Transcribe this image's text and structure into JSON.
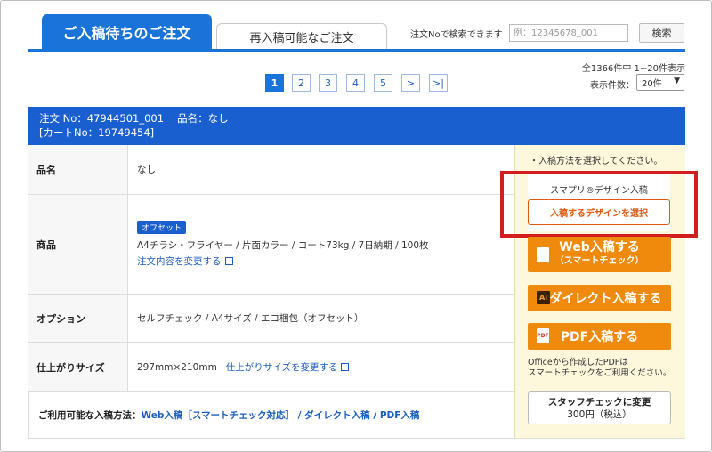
{
  "tabs": {
    "active_label": "ご入稿待ちのご注文",
    "inactive_label": "再入稿可能なご注文"
  },
  "search": {
    "label": "注文Noで検索できます",
    "placeholder": "例：12345678_001",
    "button_label": "検索"
  },
  "pagination": {
    "pages": [
      "1",
      "2",
      "3",
      "4",
      "5"
    ],
    "current": "1",
    "next_label": ">",
    "last_label": ">|"
  },
  "results": {
    "count_text": "全1366件中 1~20件表示",
    "per_page_label": "表示件数：",
    "per_page_value": "20件"
  },
  "order": {
    "header_line1": "注文 No：47944501_001　 品名：なし",
    "header_line2": "[カートNo：19749454]",
    "rows": {
      "name": {
        "label": "品名",
        "value": "なし"
      },
      "product": {
        "label": "商品",
        "badge": "オフセット",
        "value": "A4チラシ・フライヤー / 片面カラー / コート73kg / 7日納期 / 100枚",
        "link": "注文内容を変更する"
      },
      "option": {
        "label": "オプション",
        "value": "セルフチェック / A4サイズ / エコ梱包（オフセット）"
      },
      "size": {
        "label": "仕上がりサイズ",
        "value": "297mm×210mm",
        "link": "仕上がりサイズを変更する"
      }
    },
    "methods": {
      "label": "ご利用可能な入稿方法：",
      "value": "Web入稿［スマートチェック対応］ / ダイレクト入稿 / PDF入稿"
    }
  },
  "side": {
    "instruction": "・入稿方法を選択してください。",
    "sumapri_label": "スマプリ®デザイン入稿",
    "sumapri_button": "入稿するデザインを選択",
    "web_button": "Web入稿する",
    "web_button_sub": "（スマートチェック）",
    "direct_button": "ダイレクト入稿する",
    "direct_icon_text": "Ai",
    "pdf_button": "PDF入稿する",
    "pdf_icon_text": "PDF",
    "pdf_note_line1": "Officeから作成したPDFは",
    "pdf_note_line2": "スマートチェックをご利用ください。",
    "staff_button_title": "スタッフチェックに変更",
    "staff_button_price": "300円（税込）"
  },
  "colors": {
    "primary_blue": "#1a73d9",
    "header_blue": "#1a5fd0",
    "orange": "#f08a0c",
    "highlight_red": "#d21e1e",
    "panel_yellow": "#fdf8dc"
  }
}
